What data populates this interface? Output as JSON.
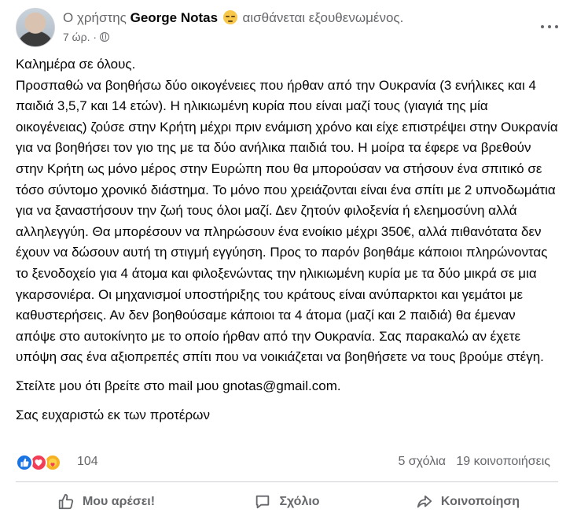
{
  "post": {
    "header": {
      "prefix": "Ο χρήστης",
      "author": "George Notas",
      "feeling_emoji": "pensive-face",
      "feeling_text": "αισθάνεται εξουθενωμένος.",
      "time": "7 ώρ.",
      "visibility_icon": "globe-icon"
    },
    "body": {
      "greeting": "Καλημέρα σε όλους.",
      "main": "Προσπαθώ να βοηθήσω δύο οικογένειες που ήρθαν από την Ουκρανία (3 ενήλικες και 4 παιδιά 3,5,7 και 14 ετών). Η ηλικιωμένη κυρία που είναι μαζί τους (γιαγιά της μία οικογένειας) ζούσε στην Κρήτη μέχρι πριν ενάμιση χρόνο και είχε επιστρέψει στην Ουκρανία για να βοηθήσει τον γιο της με τα δύο ανήλικα παιδιά του. Η μοίρα τα έφερε να βρεθούν στην Κρήτη ως μόνο μέρος στην Ευρώπη που θα μπορούσαν να στήσουν ένα σπιτικό σε τόσο σύντομο χρονικό διάστημα. Το μόνο που χρειάζονται είναι ένα σπίτι με 2 υπνοδωμάτια για να ξαναστήσουν την ζωή τους όλοι μαζί. Δεν ζητούν φιλοξενία ή ελεημοσύνη αλλά αλληλεγγύη. Θα μπορέσουν να πληρώσουν ένα ενοίκιο μέχρι 350€, αλλά πιθανότατα δεν έχουν να δώσουν αυτή τη στιγμή εγγύηση. Προς το παρόν βοηθάμε κάποιοι πληρώνοντας το ξενοδοχείο για 4 άτομα και φιλοξενώντας την ηλικιωμένη κυρία με τα δύο μικρά σε μια γκαρσονιέρα. Οι μηχανισμοί υποστήριξης του κράτους είναι ανύπαρκτοι και γεμάτοι με καθυστερήσεις. Αν δεν βοηθούσαμε κάποιοι τα 4 άτομα (μαζί και 2 παιδιά) θα έμεναν απόψε στο αυτοκίνητο με το οποίο ήρθαν από την Ουκρανία. Σας παρακαλώ αν έχετε υπόψη σας ένα αξιοπρεπές σπίτι που να νοικιάζεται να βοηθήσετε να τους βρούμε στέγη.",
      "contact": "Στείλτε μου ότι βρείτε στο mail μου gnotas@gmail.com.",
      "thanks": "Σας ευχαριστώ εκ των προτέρων"
    },
    "stats": {
      "reaction_icons": [
        "like-icon",
        "love-icon",
        "care-icon"
      ],
      "reaction_count": "104",
      "comments": "5 σχόλια",
      "shares": "19 κοινοποιήσεις"
    },
    "actions": {
      "like_label": "Μου αρέσει!",
      "comment_label": "Σχόλιο",
      "share_label": "Κοινοποίηση"
    },
    "colors": {
      "secondary_text": "#65676b",
      "primary_text": "#050505",
      "like_blue": "#1b74e4",
      "love_red": "#f33e58",
      "care_yellow": "#f7b125",
      "divider": "#ced0d4"
    }
  }
}
